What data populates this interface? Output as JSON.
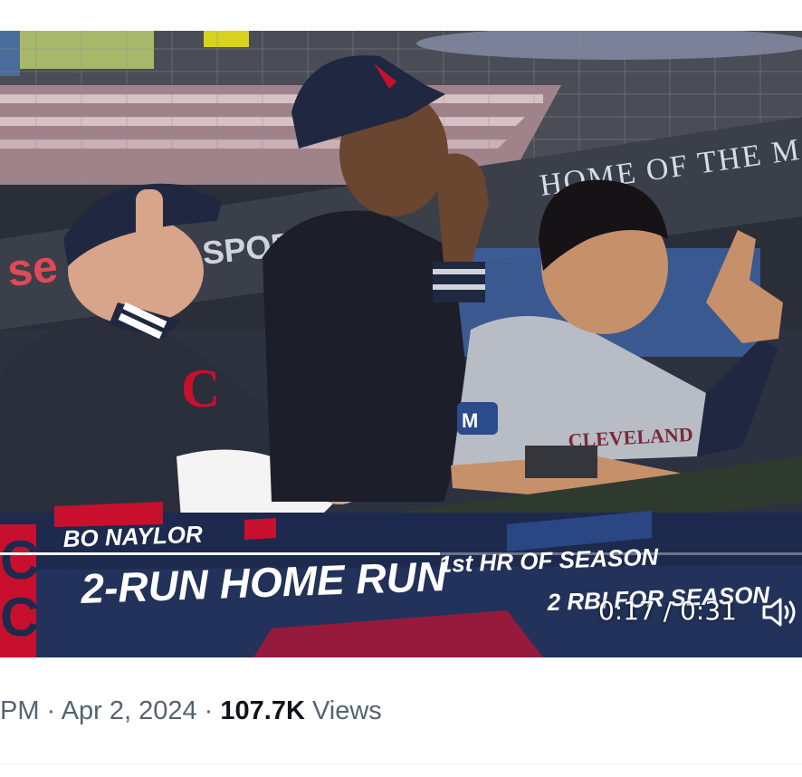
{
  "video": {
    "overlay": {
      "player_name": "BO NAYLOR",
      "headline": "2-RUN HOME RUN",
      "stat_1": "1st HR OF SEASON",
      "stat_2": "2 RBI FOR SEASON"
    },
    "dugout_signs": {
      "banner": "HOME OF THE MARINERS",
      "left_sign": "SPORT"
    },
    "jersey_text": "CLEVELAND",
    "patch_text": "M",
    "player": {
      "current_time": "0:17",
      "separator": " / ",
      "duration": "0:31",
      "progress": 0.548
    }
  },
  "tweet_meta": {
    "time_fragment": "PM",
    "sep1": " · ",
    "date": "Apr 2, 2024",
    "sep2": " · ",
    "view_count": "107.7K",
    "views_label": " Views"
  },
  "colors": {
    "guardians_navy": "#1d2a4d",
    "guardians_red": "#c8102e",
    "caption_text": "#ffffff",
    "meta_gray": "#536471"
  },
  "icons": [
    "volume-icon"
  ]
}
